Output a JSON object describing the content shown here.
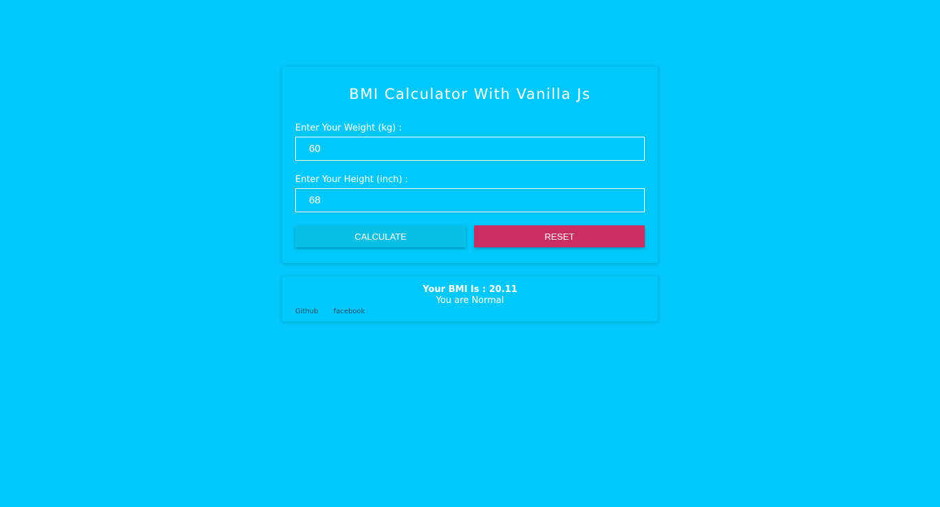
{
  "colors": {
    "background": "#00c8fa",
    "calculate_button": "#08c0e6",
    "reset_button": "#c92e62",
    "link_text": "#1f4e6b",
    "text": "#ffffff"
  },
  "calculator": {
    "title": "BMI Calculator With Vanilla Js",
    "weight": {
      "label": "Enter Your Weight (kg) :",
      "value": "60"
    },
    "height": {
      "label": "Enter Your Height (inch) :",
      "value": "68"
    },
    "calculate_label": "CALCULATE",
    "reset_label": "RESET"
  },
  "result": {
    "bmi_text": "Your BMI Is : 20.11",
    "status_text": "You are Normal"
  },
  "links": {
    "github": "Github",
    "facebook": "facebook"
  }
}
